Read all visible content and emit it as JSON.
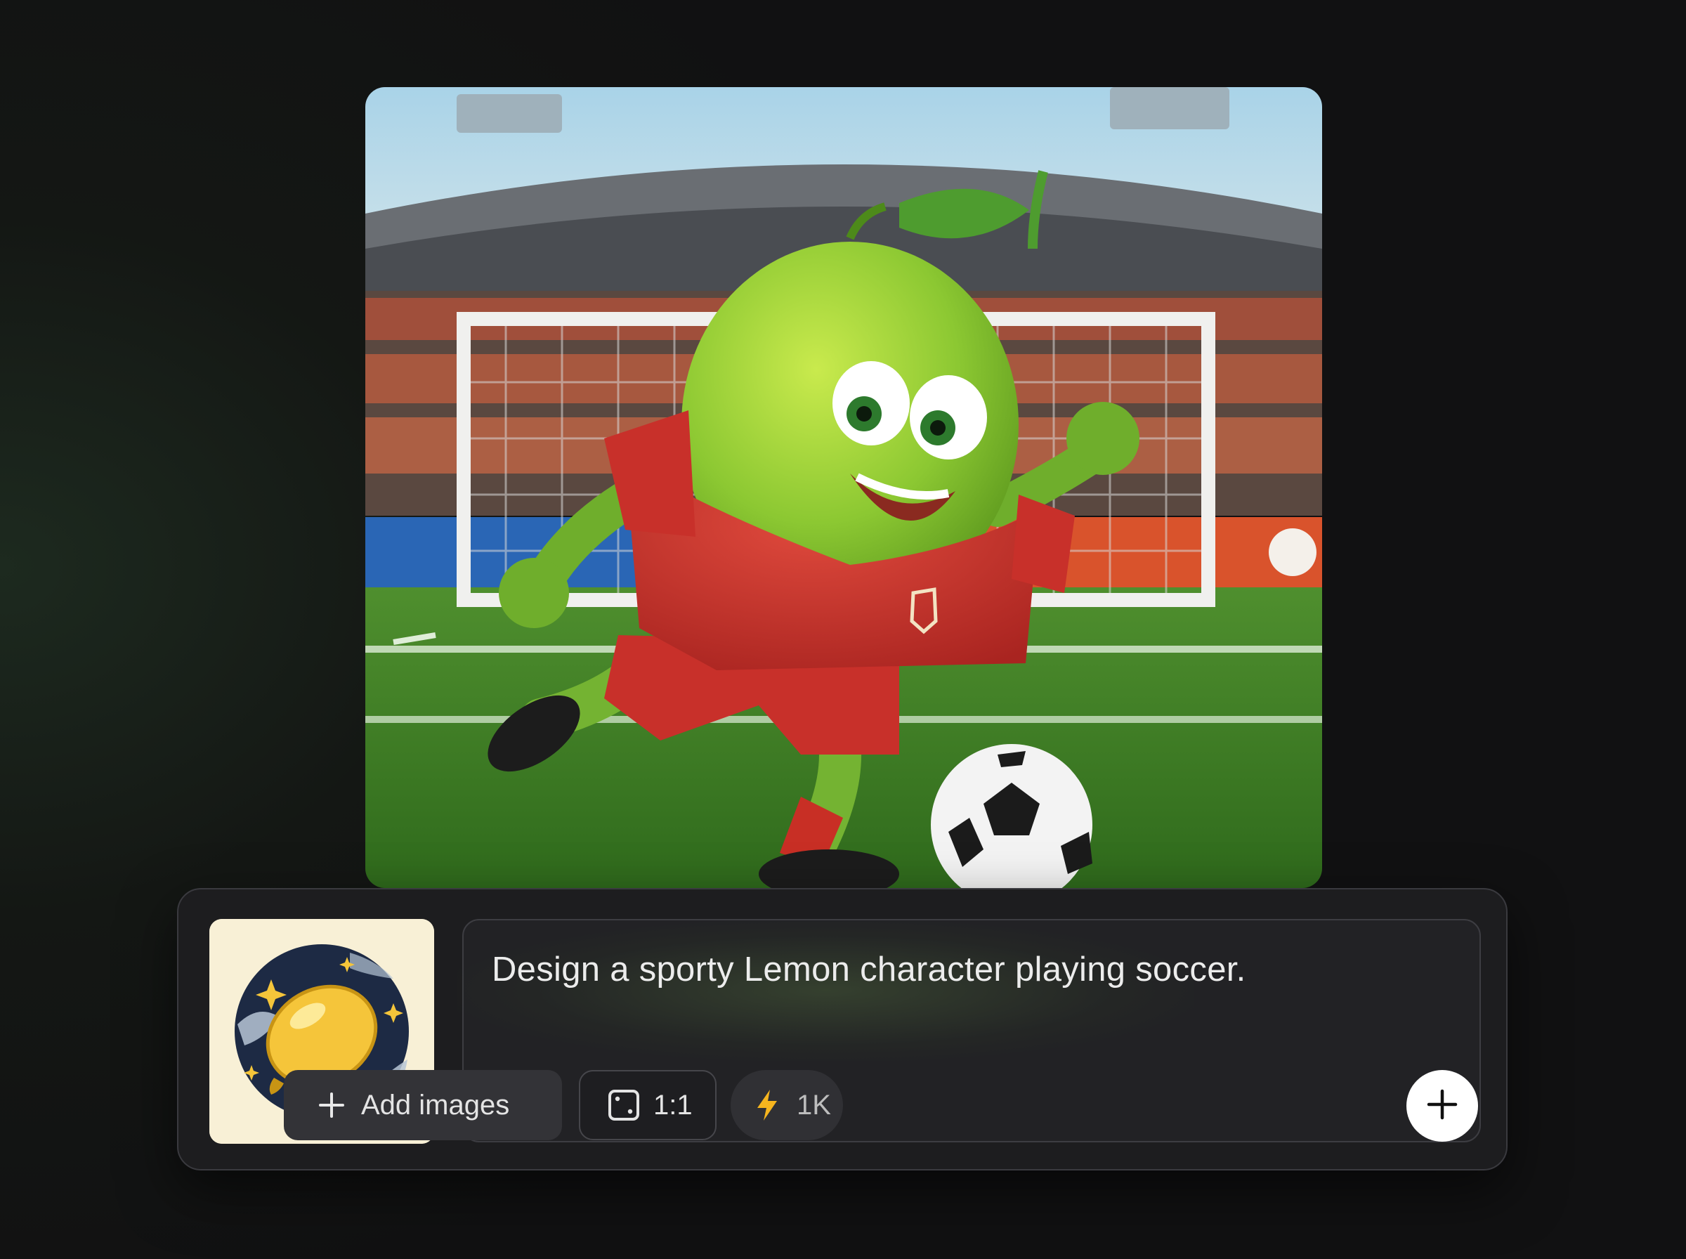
{
  "generated_image": {
    "description_icon": "lemon-soccer-character-image"
  },
  "reference_thumbnail": {
    "icon": "lemon-sticker-icon"
  },
  "prompt": {
    "text": "Design a sporty Lemon character playing soccer."
  },
  "toolbar": {
    "add_images_label": "Add images",
    "aspect_ratio_label": "1:1",
    "quality_label": "1K"
  },
  "icons": {
    "add": "plus-icon",
    "aspect": "square-dots-icon",
    "quality": "lightning-icon",
    "send": "plus-icon"
  },
  "colors": {
    "page_background": "#121213",
    "panel_background": "#1e1e20",
    "accent_lightning": "#f6b51e",
    "send_button": "#ffffff"
  }
}
